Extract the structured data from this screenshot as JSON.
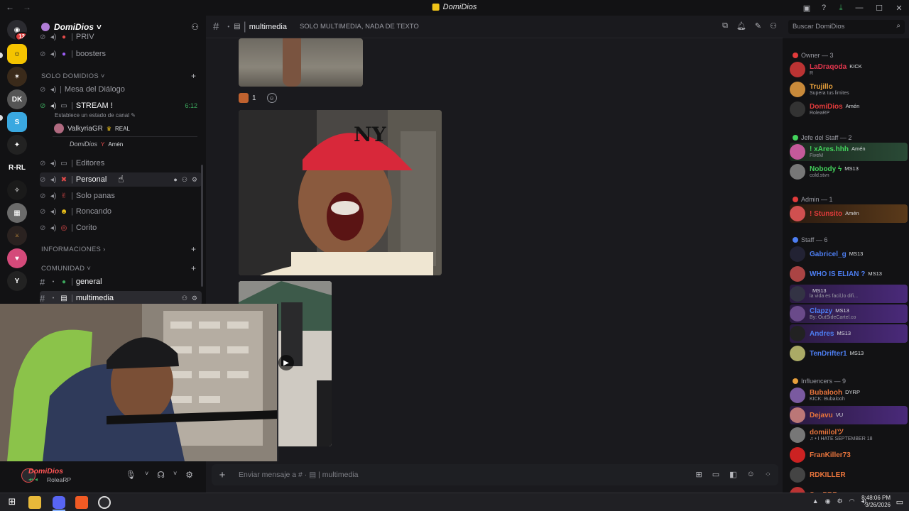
{
  "titlebar": {
    "title": "DomiDios",
    "back": "←",
    "forward": "→"
  },
  "rail": {
    "dm_badge": "13",
    "server_text": "R-RL"
  },
  "guild": {
    "name": "DomiDios ˅"
  },
  "channels": {
    "top_partial": "PRIV",
    "boosters": "boosters",
    "cat_solo": "SOLO DOMIDIOS ˅",
    "mesa": "Mesa del Diálogo",
    "stream": "STREAM !",
    "stream_time": "6:12",
    "stream_status": "Establece un estado de canal ✎",
    "vu1_name": "ValkyriaGR",
    "vu1_tag": "REAL",
    "vu2_name": "DomiDios",
    "vu2_tag": "Amén",
    "editores": "Editores",
    "personal": "Personal",
    "solo_panas": "Solo panas",
    "roncando": "Roncando",
    "corito": "Corito",
    "cat_info": "INFORMACIONES ›",
    "cat_com": "COMUNIDAD ˅",
    "general": "general",
    "multimedia": "multimedia"
  },
  "header": {
    "channel": "multimedia",
    "topic": "SOLO MULTIMEDIA, NADA DE TEXTO",
    "search_placeholder": "Buscar DomiDios"
  },
  "chat": {
    "reaction_count": "1"
  },
  "composer": {
    "placeholder": "Enviar mensaje a # · ▤ | multimedia"
  },
  "user": {
    "name": "DomiDios",
    "status": "RoleaRP"
  },
  "members": {
    "owner_cat": "Owner — 3",
    "owner": [
      {
        "name": "LaDraqoda",
        "tag": "KICK",
        "sub": "R",
        "color": "#e0364d"
      },
      {
        "name": "Trujillo",
        "tag": "",
        "sub": "Supera tus limites",
        "color": "#e8a03c"
      },
      {
        "name": "DomiDios",
        "tag": "Amén",
        "sub": "RoleaRP",
        "color": "#e23b3b"
      }
    ],
    "jefe_cat": "Jefe del Staff — 2",
    "jefe": [
      {
        "name": "! xAres.hhh",
        "tag": "Amén",
        "sub": "FiveM",
        "color": "#43d35c"
      },
      {
        "name": "Nobody ϟ",
        "tag": "MS13",
        "sub": "cold.stvn",
        "color": "#43d35c"
      }
    ],
    "admin_cat": "Admin — 1",
    "admin": [
      {
        "name": "! Stunsito",
        "tag": "Amén",
        "sub": "",
        "color": "#e23b3b"
      }
    ],
    "staff_cat": "Staff — 6",
    "staff": [
      {
        "name": "Gabricel_g",
        "tag": "MS13",
        "sub": "",
        "color": "#4d7ef2"
      },
      {
        "name": "WHO IS ELIAN ?",
        "tag": "MS13",
        "sub": "",
        "color": "#4d7ef2"
      },
      {
        "name": "",
        "tag": "MS13",
        "sub": "la vida es facil,lo difi...",
        "color": "#4d7ef2"
      },
      {
        "name": "Clapzy",
        "tag": "MS13",
        "sub": "By: OutSideCartel.co",
        "color": "#4d7ef2"
      },
      {
        "name": "Andres",
        "tag": "MS13",
        "sub": "",
        "color": "#4d7ef2"
      },
      {
        "name": "TenDrifter1",
        "tag": "MS13",
        "sub": "",
        "color": "#4d7ef2"
      }
    ],
    "infl_cat": "Influencers — 9",
    "infl": [
      {
        "name": "Bubalooh",
        "tag": "DYRP",
        "sub": "KICK: Bubalooh",
        "color": "#e8743c"
      },
      {
        "name": "Dejavu",
        "tag": "VU",
        "sub": "",
        "color": "#e8743c"
      },
      {
        "name": "domiilolツ",
        "tag": "",
        "sub": "♫ • I HATE SEPTEMBER 18",
        "color": "#e8743c"
      },
      {
        "name": "FranKiller73",
        "tag": "",
        "sub": "",
        "color": "#e8743c"
      },
      {
        "name": "RDKILLER",
        "tag": "",
        "sub": "",
        "color": "#e8743c"
      },
      {
        "name": "SqyPRZ",
        "tag": "",
        "sub": "",
        "color": "#e8743c"
      }
    ]
  },
  "taskbar": {
    "time": "8:48:06 PM",
    "date": "3/26/2026"
  }
}
